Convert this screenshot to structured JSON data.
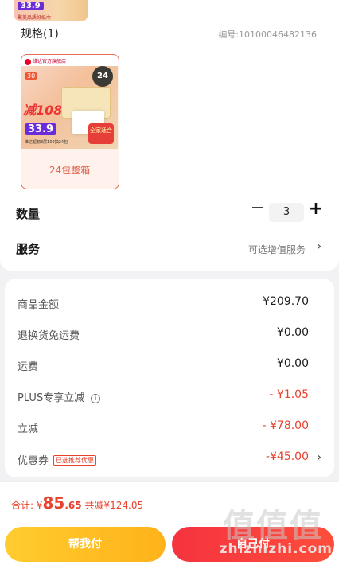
{
  "top_thumb": {
    "price": "33.9",
    "tiny_text": "聚美品质好纸巾"
  },
  "spec": {
    "title": "规格(1)",
    "code": "编号:10100046482136",
    "option": {
      "label": "24包整箱",
      "img_header": "维达官方旗舰店",
      "img_badge": "24",
      "img_qty": "30",
      "img_minus": "减108",
      "img_price": "33.9",
      "img_redbox": "全家适合",
      "img_small": "维达超韧3层100抽24包"
    }
  },
  "quantity": {
    "label": "数量",
    "value": "3",
    "minus": "−",
    "plus": "+"
  },
  "service": {
    "label": "服务",
    "value": "可选增值服务",
    "chevron": "›"
  },
  "summary": {
    "items": [
      {
        "label": "商品金额",
        "value": "¥209.70"
      },
      {
        "label": "退换货免运费",
        "value": "¥0.00"
      },
      {
        "label": "运费",
        "value": "¥0.00"
      },
      {
        "label": "PLUS专享立减",
        "value": "- ¥1.05"
      },
      {
        "label": "立减",
        "value": "- ¥78.00"
      },
      {
        "label": "优惠券",
        "value": "-¥45.00",
        "tag": "已选推荐优惠"
      }
    ]
  },
  "footer": {
    "total_label": "合计:",
    "currency": "¥",
    "total_int": "85",
    "total_dec": ".65",
    "saved_label": "共减",
    "saved_value": "¥124.05",
    "help_pay": "帮我付",
    "self_pay": "自己付"
  },
  "watermark": {
    "logo": "值值值",
    "site": "zhizhizhi.com"
  },
  "colors": {
    "accent": "#e8412c",
    "help": "#ffc21f",
    "pay": "#f5333f"
  }
}
